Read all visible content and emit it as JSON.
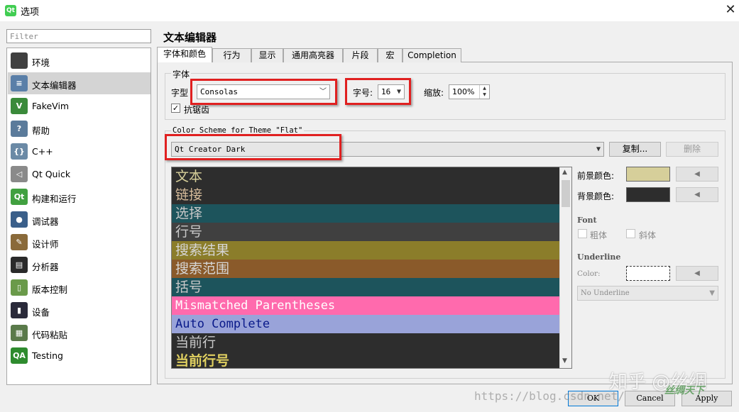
{
  "window": {
    "title": "选项",
    "app_icon_text": "Qt",
    "close_glyph": "✕"
  },
  "filter": {
    "placeholder": "Filter"
  },
  "sidebar": {
    "items": [
      {
        "label": "环境",
        "icon": "monitor-icon",
        "icon_text": "",
        "color": "#404040"
      },
      {
        "label": "文本编辑器",
        "icon": "text-editor-icon",
        "icon_text": "≡",
        "color": "#5a7fa8"
      },
      {
        "label": "FakeVim",
        "icon": "fakevim-icon",
        "icon_text": "V",
        "color": "#3a8a3a"
      },
      {
        "label": "帮助",
        "icon": "help-icon",
        "icon_text": "?",
        "color": "#5b7b9b"
      },
      {
        "label": "C++",
        "icon": "cpp-braces-icon",
        "icon_text": "{}",
        "color": "#6b8aa6"
      },
      {
        "label": "Qt Quick",
        "icon": "qtquick-icon",
        "icon_text": "◁",
        "color": "#8a8a8a"
      },
      {
        "label": "构建和运行",
        "icon": "build-run-icon",
        "icon_text": "Qt",
        "color": "#41a040"
      },
      {
        "label": "调试器",
        "icon": "debugger-icon",
        "icon_text": "●",
        "color": "#3a5f8a"
      },
      {
        "label": "设计师",
        "icon": "designer-icon",
        "icon_text": "✎",
        "color": "#8a6a3a"
      },
      {
        "label": "分析器",
        "icon": "analyzer-icon",
        "icon_text": "▤",
        "color": "#2a2a2a"
      },
      {
        "label": "版本控制",
        "icon": "version-control-icon",
        "icon_text": "▯",
        "color": "#6a9a4a"
      },
      {
        "label": "设备",
        "icon": "device-icon",
        "icon_text": "▮",
        "color": "#2a2a3a"
      },
      {
        "label": "代码粘贴",
        "icon": "code-paste-icon",
        "icon_text": "▦",
        "color": "#5a7a4a"
      },
      {
        "label": "Testing",
        "icon": "qa-testing-icon",
        "icon_text": "QA",
        "color": "#2e8b2e"
      }
    ],
    "selected_index": 1
  },
  "page": {
    "title": "文本编辑器"
  },
  "tabs": [
    "字体和颜色",
    "行为",
    "显示",
    "通用高亮器",
    "片段",
    "宏",
    "Completion"
  ],
  "font_group": {
    "title": "字体",
    "family_label": "字型",
    "family_value": "Consolas",
    "size_label": "字号:",
    "size_value": "16",
    "zoom_label": "缩放:",
    "zoom_value": "100%",
    "antialias_label": "抗锯齿",
    "antialias_checked": true
  },
  "scheme": {
    "group_title": "Color Scheme for Theme \"Flat\"",
    "value": "Qt Creator Dark",
    "copy_label": "复制...",
    "delete_label": "删除"
  },
  "preview_rows": [
    {
      "text": "文本",
      "bg": "#2d2d2d",
      "fg": "#d6cf9a"
    },
    {
      "text": "链接",
      "bg": "#2d2d2d",
      "fg": "#d6bb9a"
    },
    {
      "text": "选择",
      "bg": "#1d545c",
      "fg": "#c8c8c8"
    },
    {
      "text": "行号",
      "bg": "#404040",
      "fg": "#c8c8c8"
    },
    {
      "text": "搜索结果",
      "bg": "#8b7d2a",
      "fg": "#d6d6d6"
    },
    {
      "text": "搜索范围",
      "bg": "#8a5a2a",
      "fg": "#d6d6d6"
    },
    {
      "text": "括号",
      "bg": "#1d545c",
      "fg": "#c8c8c8"
    },
    {
      "text": "Mismatched Parentheses",
      "bg": "#ff6aad",
      "fg": "#ffffff"
    },
    {
      "text": "Auto Complete",
      "bg": "#99a3d9",
      "fg": "#0a1a8a"
    },
    {
      "text": "当前行",
      "bg": "#2d2d2d",
      "fg": "#c8c8c8"
    },
    {
      "text": "当前行号",
      "bg": "#2d2d2d",
      "fg": "#e0d060"
    }
  ],
  "attributes": {
    "foreground_label": "前景颜色:",
    "foreground_color": "#d6cf9a",
    "background_label": "背景颜色:",
    "background_color": "#2d2d2d",
    "reset_glyph": "◀",
    "font_heading": "Font",
    "bold_label": "粗体",
    "italic_label": "斜体",
    "underline_heading": "Underline",
    "underline_color_label": "Color:",
    "underline_style": "No Underline"
  },
  "footer": {
    "ok": "OK",
    "cancel": "Cancel",
    "apply": "Apply",
    "url_watermark": "https://blog.csdn.net/",
    "zhihu_watermark": "知乎 @丝绸",
    "logo_watermark": "丝绸天下"
  }
}
